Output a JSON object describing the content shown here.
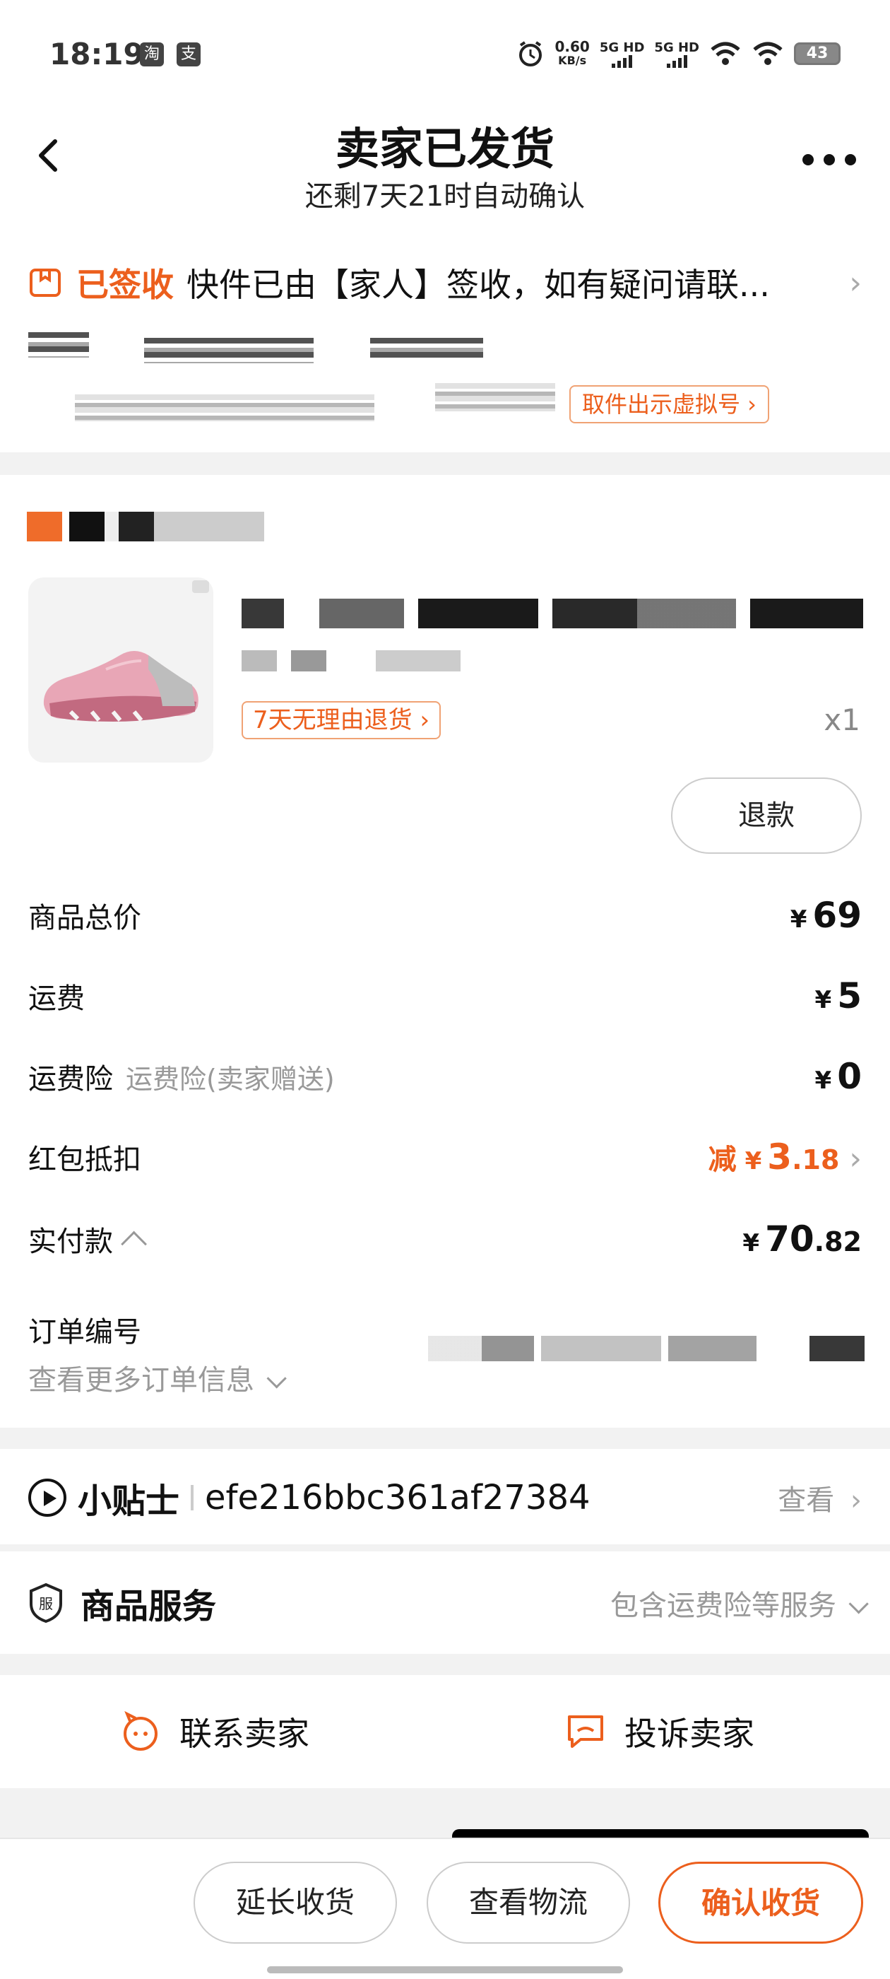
{
  "status_bar": {
    "time": "18:19",
    "app_icon_1": "淘",
    "app_icon_2": "支",
    "speed_value": "0.60",
    "speed_unit": "KB/s",
    "net1": "5G HD",
    "net2": "5G HD",
    "battery": "43"
  },
  "header": {
    "title": "卖家已发货",
    "subtitle": "还剩7天21时自动确认"
  },
  "logistics": {
    "status": "已签收",
    "text": "快件已由【家人】签收，如有疑问请联...",
    "pickup_button": "取件出示虚拟号 ›"
  },
  "order": {
    "return_policy": "7天无理由退货 ›",
    "quantity": "x1",
    "refund_button": "退款",
    "rows": {
      "goods_total_label": "商品总价",
      "goods_total_value": "69",
      "shipping_label": "运费",
      "shipping_value": "5",
      "insurance_label": "运费险",
      "insurance_sub": "运费险(卖家赠送)",
      "insurance_value": "0",
      "redpack_label": "红包抵扣",
      "redpack_prefix": "减",
      "redpack_int": "3",
      "redpack_dec": ".18",
      "paid_label": "实付款",
      "paid_int": "70",
      "paid_dec": ".82",
      "order_no_label": "订单编号"
    },
    "currency": "¥",
    "more_info": "查看更多订单信息"
  },
  "tips": {
    "title": "小贴士",
    "code": "efe216bbc361af27384",
    "view": "查看"
  },
  "service": {
    "title": "商品服务",
    "desc": "包含运费险等服务"
  },
  "contact": {
    "seller": "联系卖家",
    "complain": "投诉卖家"
  },
  "bottom": {
    "extend": "延长收货",
    "logistics": "查看物流",
    "confirm": "确认收货"
  },
  "colors": {
    "accent": "#ec5f1d"
  }
}
